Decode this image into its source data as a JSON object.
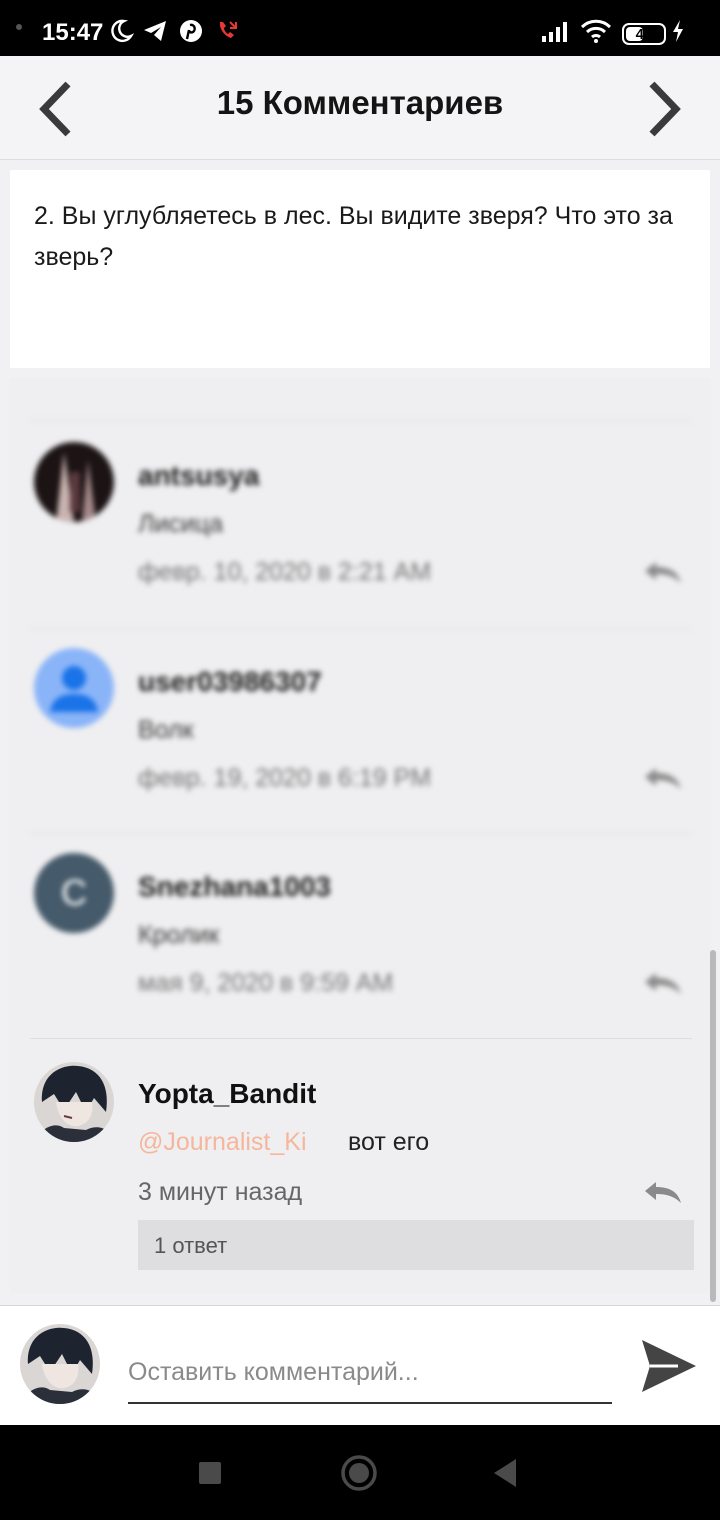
{
  "status_bar": {
    "time": "15:47",
    "battery": "46",
    "battery_level": 0.46,
    "icons": [
      "moon-icon",
      "telegram-icon",
      "pinterest-icon",
      "missed-call-icon",
      "signal-icon",
      "wifi-icon",
      "battery-icon",
      "charging-icon"
    ]
  },
  "header": {
    "title": "15 Комментариев",
    "prev_icon": "chevron-left-icon",
    "next_icon": "chevron-right-icon"
  },
  "question": {
    "text": "2. Вы углубляетесь в лес. Вы видите зверя? Что это за зверь?"
  },
  "comments": [
    {
      "user": "antsusya",
      "text": "Лисица",
      "time": "февр. 10, 2020 в 2:21 AM",
      "blurred": true
    },
    {
      "user": "user03986307",
      "text": "Волк",
      "time": "февр. 19, 2020 в 6:19 PM",
      "blurred": true
    },
    {
      "user": "Snezhana1003",
      "text": "Кролик",
      "time": "мая 9, 2020 в 9:59 AM",
      "avatar_letter": "C",
      "blurred": true
    },
    {
      "user": "Yopta_Bandit",
      "mention": "@Journalist_Ki",
      "text": "вот его",
      "time": "3 минут назад",
      "replies": "1 ответ",
      "blurred": false
    }
  ],
  "composer": {
    "placeholder": "Оставить комментарий...",
    "send_icon": "send-icon"
  },
  "nav_bar": {
    "icons": [
      "recents-square-icon",
      "home-circle-icon",
      "back-triangle-icon"
    ]
  },
  "colors": {
    "mention": "#f6b69b",
    "background": "#f1f0f2",
    "status_bar": "#000000"
  }
}
